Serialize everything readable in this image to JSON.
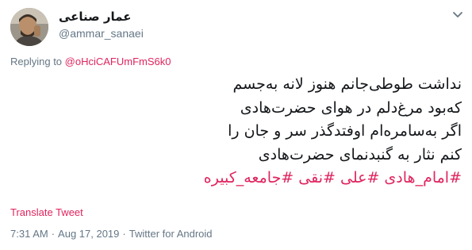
{
  "user": {
    "display_name": "عمار صناعی",
    "handle": "@ammar_sanaei"
  },
  "reply": {
    "prefix": "Replying to ",
    "target": "@oHciCAFUmFmS6k0"
  },
  "tweet": {
    "lines": [
      "نداشت طوطی‌جانم هنوز لانه به‌جسم",
      "که‌بود مرغ‌دلم در هوای حضرت‌هادی",
      "اگر به‌سامره‌ام اوفتدگذر سر و جان را",
      "کنم نثار به گنبدنمای حضرت‌هادی"
    ],
    "hashtags": [
      "#امام_هادی",
      "#علی",
      "#نقی",
      "#جامعه_کبیره"
    ]
  },
  "translate_label": "Translate Tweet",
  "meta": {
    "time": "7:31 AM",
    "separator": "·",
    "date": "Aug 17, 2019",
    "source": "Twitter for Android"
  },
  "icons": {
    "caret": "chevron-down-icon"
  },
  "colors": {
    "accent": "#e0245e",
    "secondary_text": "#657786",
    "primary_text": "#14171a"
  }
}
